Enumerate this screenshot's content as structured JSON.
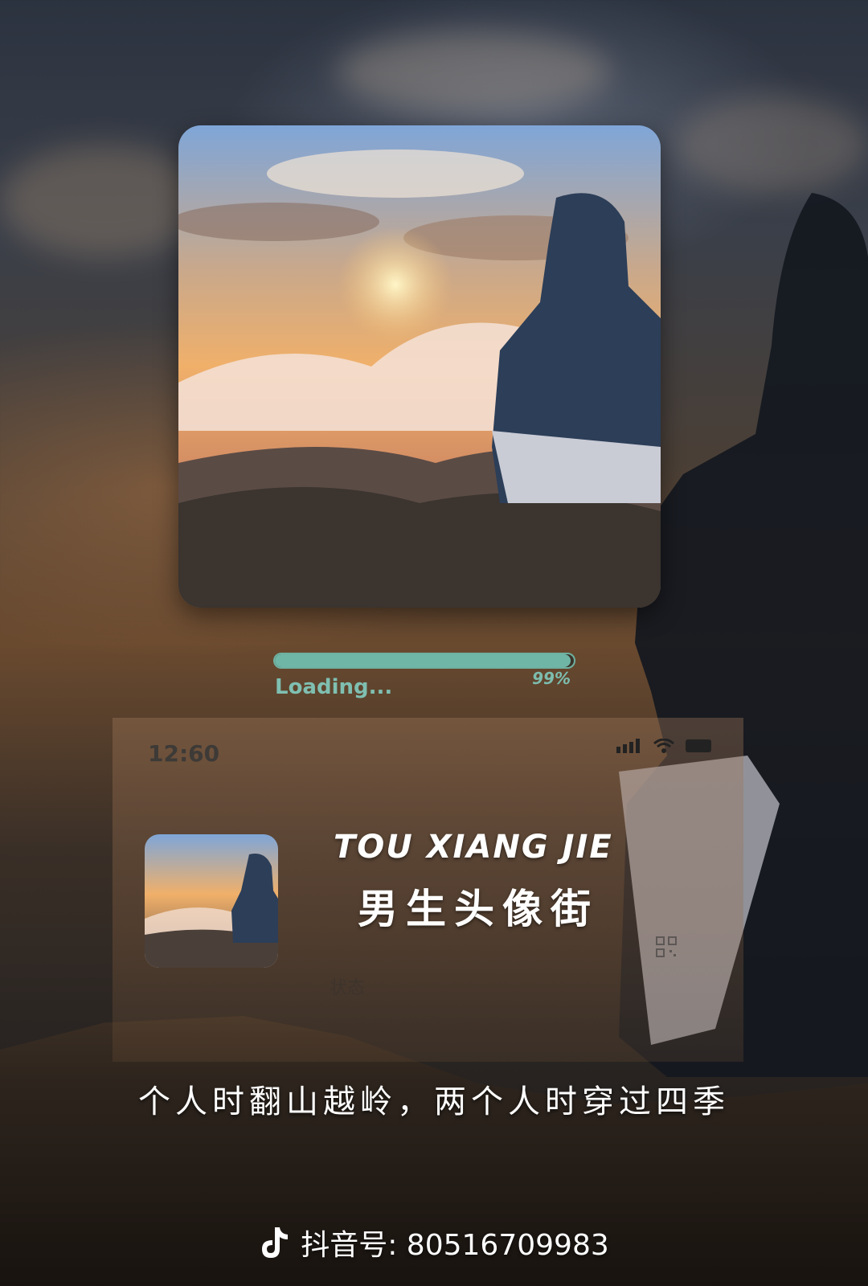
{
  "loader": {
    "label": "Loading...",
    "percent_text": "99%",
    "progress": 0.99
  },
  "panel": {
    "time": "12:60",
    "brand_en": "TOU XIANG JIE",
    "brand_cn": "男生头像街",
    "status_word": "状态"
  },
  "caption": "个人时翻山越岭，两个人时穿过四季",
  "footer": {
    "label": "抖音号: 80516709983"
  },
  "icons": [
    "signal-icon",
    "wifi-icon",
    "battery-icon",
    "qr-code-icon",
    "tiktok-icon"
  ],
  "colors": {
    "accent": "#6fb6a6"
  }
}
